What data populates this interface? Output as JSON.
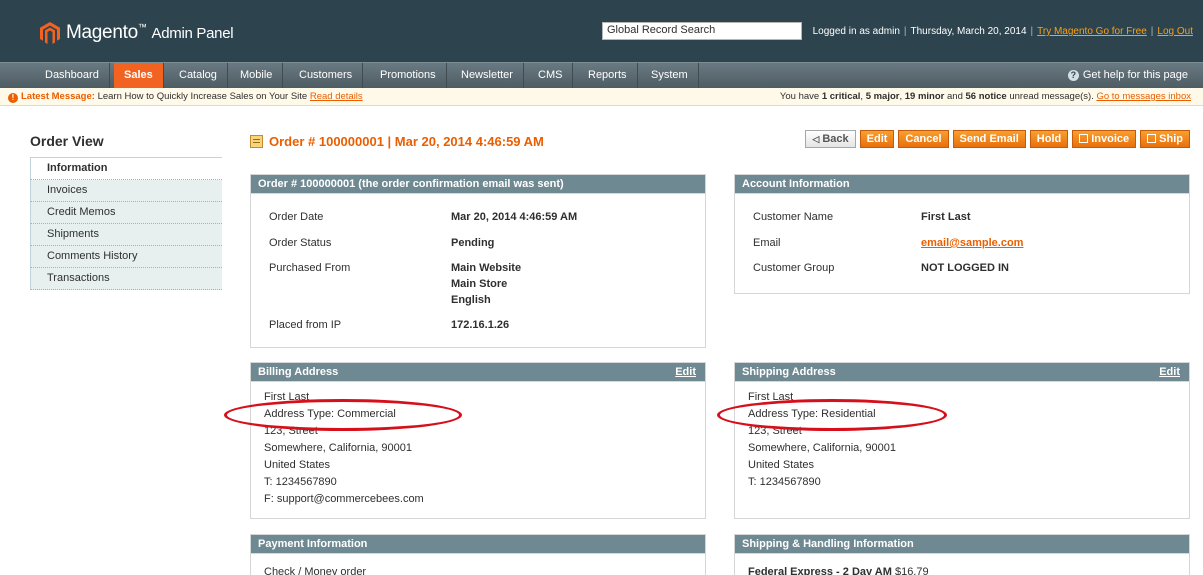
{
  "header": {
    "logo_main": "Magento",
    "logo_sub": "Admin Panel",
    "search_value": "Global Record Search",
    "logged_in": "Logged in as admin",
    "date": "Thursday, March 20, 2014",
    "try_link": "Try Magento Go for Free",
    "logout": "Log Out"
  },
  "nav": {
    "items": [
      "Dashboard",
      "Sales",
      "Catalog",
      "Mobile",
      "Customers",
      "Promotions",
      "Newsletter",
      "CMS",
      "Reports",
      "System"
    ],
    "active": "Sales",
    "help": "Get help for this page"
  },
  "message": {
    "label": "Latest Message:",
    "text": "Learn How to Quickly Increase Sales on Your Site",
    "link": "Read details",
    "right_prefix": "You have",
    "critical": "1 critical",
    "major": "5 major",
    "minor": "19 minor",
    "notice": "56 notice",
    "right_suffix": "unread message(s).",
    "inbox_link": "Go to messages inbox"
  },
  "sidebar": {
    "title": "Order View",
    "items": [
      "Information",
      "Invoices",
      "Credit Memos",
      "Shipments",
      "Comments History",
      "Transactions"
    ]
  },
  "page": {
    "title": "Order # 100000001 | Mar 20, 2014 4:46:59 AM",
    "buttons": {
      "back": "Back",
      "edit": "Edit",
      "cancel": "Cancel",
      "send_email": "Send Email",
      "hold": "Hold",
      "invoice": "Invoice",
      "ship": "Ship"
    }
  },
  "order_box": {
    "title": "Order # 100000001 (the order confirmation email was sent)",
    "order_date_label": "Order Date",
    "order_date": "Mar 20, 2014 4:46:59 AM",
    "status_label": "Order Status",
    "status": "Pending",
    "purchased_label": "Purchased From",
    "purchased": [
      "Main Website",
      "Main Store",
      "English"
    ],
    "ip_label": "Placed from IP",
    "ip": "172.16.1.26"
  },
  "account_box": {
    "title": "Account Information",
    "name_label": "Customer Name",
    "name": "First Last",
    "email_label": "Email",
    "email": "email@sample.com",
    "group_label": "Customer Group",
    "group": "NOT LOGGED IN"
  },
  "billing": {
    "title": "Billing Address",
    "edit": "Edit",
    "lines": [
      "First Last",
      "Address Type: Commercial",
      "123, Street",
      "Somewhere, California, 90001",
      "United States",
      "T: 1234567890",
      "F: support@commercebees.com"
    ]
  },
  "shipping": {
    "title": "Shipping Address",
    "edit": "Edit",
    "lines": [
      "First Last",
      "Address Type: Residential",
      "123, Street",
      "Somewhere, California, 90001",
      "United States",
      "T: 1234567890"
    ]
  },
  "payment": {
    "title": "Payment Information",
    "method": "Check / Money order"
  },
  "shipping_handling": {
    "title": "Shipping & Handling Information",
    "method": "Federal Express - 2 Day AM",
    "price": "$16.79"
  },
  "colors": {
    "header_bg": "#2d444f",
    "accent": "#eb5e00",
    "box_head": "#6f8992",
    "annotation": "#d6101b"
  }
}
